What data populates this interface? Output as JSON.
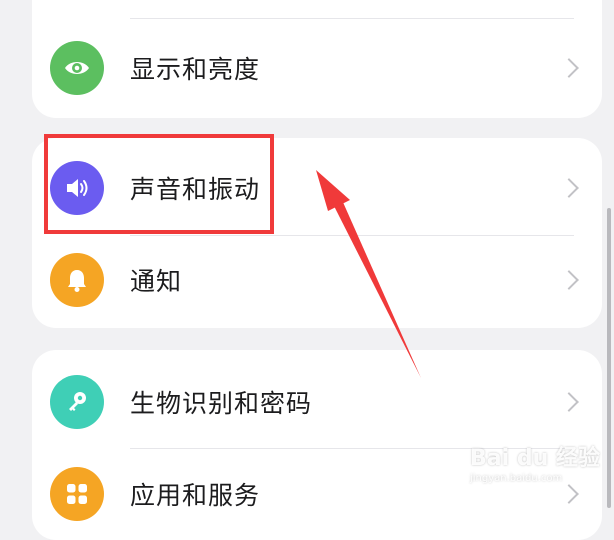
{
  "settings_items": [
    {
      "label": "显示和亮度",
      "icon": "eye-icon",
      "color": "#5cbf60"
    },
    {
      "label": "声音和振动",
      "icon": "speaker-icon",
      "color": "#6b5cf0"
    },
    {
      "label": "通知",
      "icon": "bell-icon",
      "color": "#f5a524"
    },
    {
      "label": "生物识别和密码",
      "icon": "key-icon",
      "color": "#3fcfb6"
    },
    {
      "label": "应用和服务",
      "icon": "apps-grid-icon",
      "color": "#f5a524"
    }
  ],
  "annotation": {
    "highlight_color": "#f03a3a",
    "highlighted_item": "声音和振动"
  },
  "watermark": {
    "brand": "Bai du 经验",
    "domain": "jingyan.baidu.com"
  }
}
